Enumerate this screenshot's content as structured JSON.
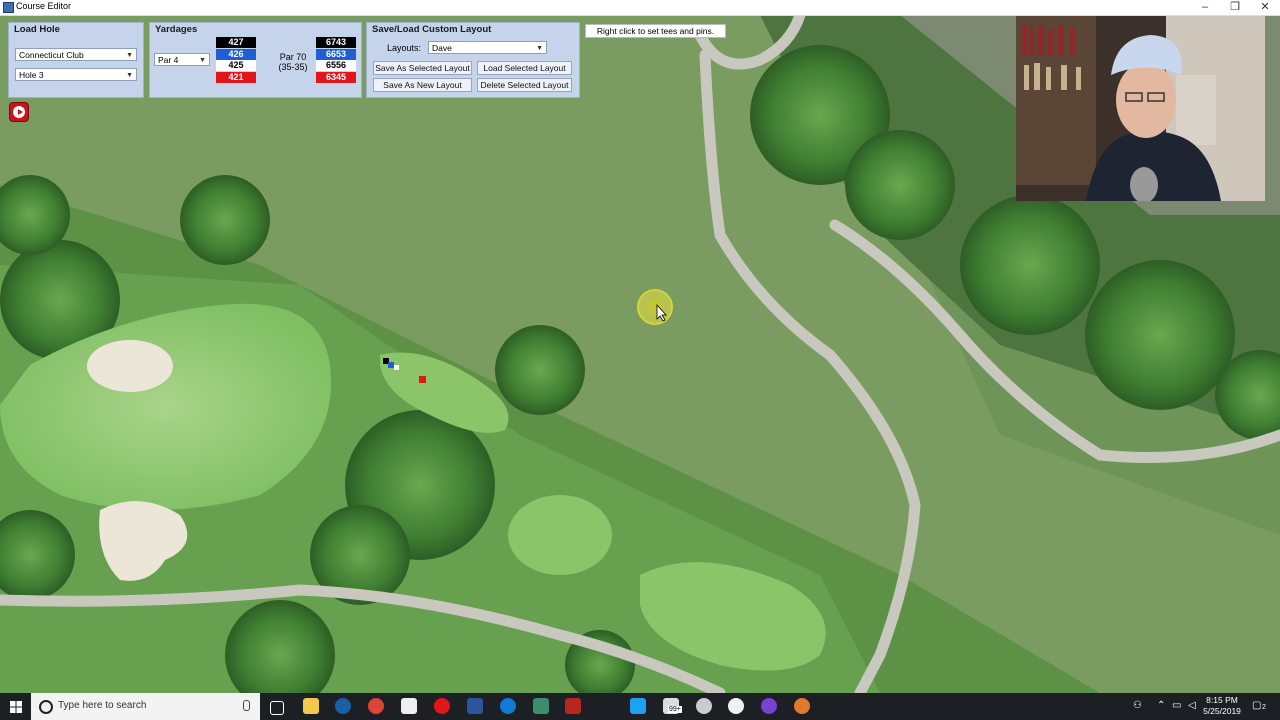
{
  "window": {
    "title": "Course Editor"
  },
  "load_hole": {
    "title": "Load Hole",
    "course": "Connecticut Club",
    "hole": "Hole 3"
  },
  "yardages": {
    "title": "Yardages",
    "par_select": "Par 4",
    "hole_yards": [
      {
        "value": "427",
        "color": "#000000"
      },
      {
        "value": "426",
        "color": "#1f5fd6"
      },
      {
        "value": "425",
        "color": "#ffffff"
      },
      {
        "value": "421",
        "color": "#e0161b"
      }
    ],
    "course_par": "Par 70",
    "course_split": "(35-35)",
    "course_yards": [
      {
        "value": "6743",
        "color": "#000000"
      },
      {
        "value": "6653",
        "color": "#1f5fd6"
      },
      {
        "value": "6556",
        "color": "#ffffff"
      },
      {
        "value": "6345",
        "color": "#e0161b"
      }
    ]
  },
  "layout": {
    "title": "Save/Load Custom Layout",
    "layouts_label": "Layouts:",
    "layouts_value": "Dave",
    "save_as_selected": "Save As Selected Layout",
    "load_selected": "Load Selected Layout",
    "save_as_new": "Save As New Layout",
    "delete_selected": "Delete Selected Layout"
  },
  "hint": "Right click to set tees and pins.",
  "colors": {
    "panel": "#c5d4ea",
    "tee_red": "#e0161b",
    "tee_blue": "#1f5fd6",
    "cursor_ring": "#e3e043"
  },
  "taskbar": {
    "search_placeholder": "Type here to search",
    "time": "8:15 PM",
    "date": "5/25/2019",
    "badge": "99+",
    "notification_count": "2"
  }
}
